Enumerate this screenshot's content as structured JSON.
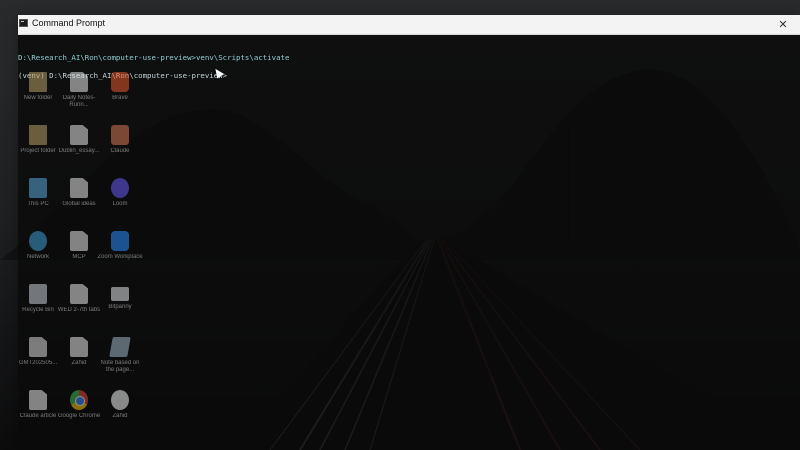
{
  "window": {
    "title": "Command Prompt",
    "close_glyph": "✕"
  },
  "console": {
    "lines": [
      "D:\\Research_AI\\Ron\\computer-use-preview>venv\\Scripts\\activate",
      "(venv) D:\\Research_AI\\Ron\\computer-use-preview>"
    ]
  },
  "desktop_icons": [
    {
      "label": "New folder",
      "icon": "folder-icon"
    },
    {
      "label": "Daily Notes-Runn...",
      "icon": "document-icon"
    },
    {
      "label": "Brave",
      "icon": "brave-icon"
    },
    {
      "label": "Project folder",
      "icon": "folder-icon"
    },
    {
      "label": "Dublin_essay...",
      "icon": "document-icon"
    },
    {
      "label": "Claude",
      "icon": "claude-icon"
    },
    {
      "label": "This PC",
      "icon": "computer-icon"
    },
    {
      "label": "Global ideas",
      "icon": "document-icon"
    },
    {
      "label": "Loom",
      "icon": "loom-icon"
    },
    {
      "label": "Network",
      "icon": "network-icon"
    },
    {
      "label": "MCP",
      "icon": "document-icon"
    },
    {
      "label": "Zoom Workplace",
      "icon": "zoom-icon"
    },
    {
      "label": "Recycle Bin",
      "icon": "recycle-bin-icon"
    },
    {
      "label": "WED 2-7th tabs",
      "icon": "document-icon"
    },
    {
      "label": "Bitpanny",
      "icon": "app-icon"
    },
    {
      "label": "GMT202505...",
      "icon": "image-icon"
    },
    {
      "label": "Zahid",
      "icon": "document-icon"
    },
    {
      "label": "Note based on the page...",
      "icon": "note-icon"
    },
    {
      "label": "Claude article",
      "icon": "document-icon"
    },
    {
      "label": "Google Chrome",
      "icon": "chrome-icon"
    },
    {
      "label": "Zahid",
      "icon": "chrome-profile-icon"
    }
  ],
  "colors": {
    "console_bg": "#0a0a0a",
    "prompt_text": "#8fd0d6",
    "titlebar": "#f3f3f3"
  }
}
